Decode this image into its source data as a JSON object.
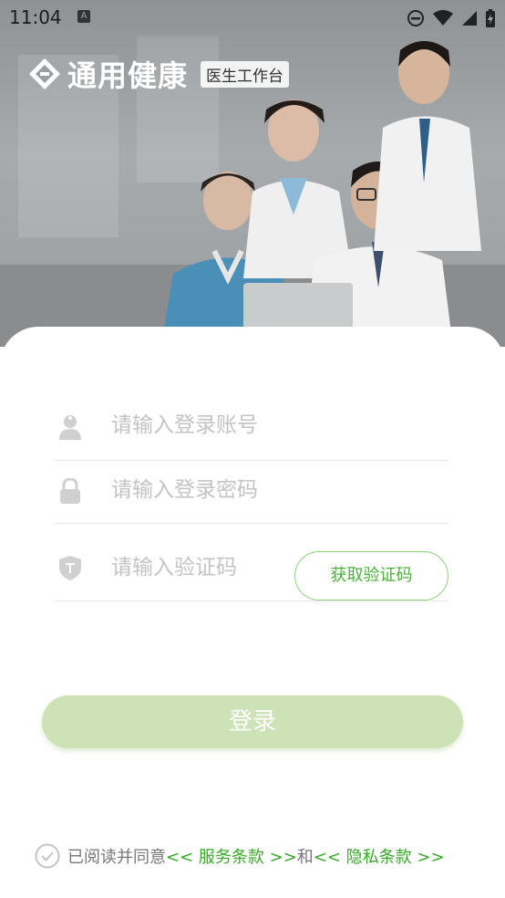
{
  "status_bar": {
    "time": "11:04",
    "a_badge": "A"
  },
  "brand": {
    "name": "通用健康",
    "tag": "医生工作台"
  },
  "login_form": {
    "account_placeholder": "请输入登录账号",
    "password_placeholder": "请输入登录密码",
    "code_placeholder": "请输入验证码",
    "get_code_label": "获取验证码",
    "login_label": "登录"
  },
  "agreement": {
    "prefix": "已阅读并同意",
    "service_link": "<< 服务条款 >>",
    "conjunction": "和",
    "privacy_link": "<< 隐私条款 >>"
  },
  "colors": {
    "accent_green": "#3aa72b",
    "login_button_disabled": "#cde3b7",
    "code_button_border": "#8fd17f"
  }
}
